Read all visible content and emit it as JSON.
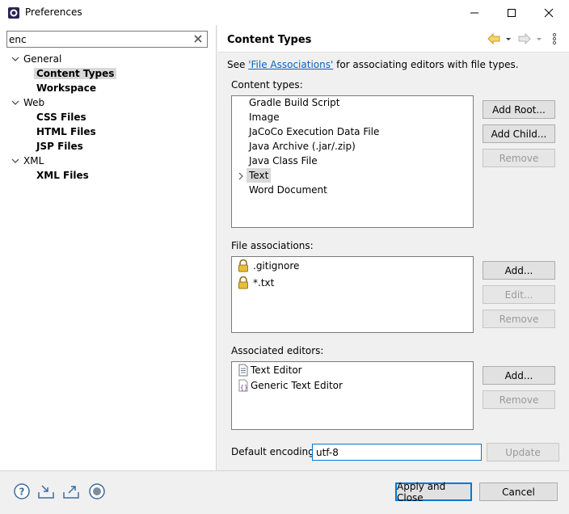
{
  "window": {
    "title": "Preferences"
  },
  "filter": {
    "value": "enc"
  },
  "tree": {
    "groups": [
      {
        "label": "General",
        "children": [
          "Content Types",
          "Workspace"
        ]
      },
      {
        "label": "Web",
        "children": [
          "CSS Files",
          "HTML Files",
          "JSP Files"
        ]
      },
      {
        "label": "XML",
        "children": [
          "XML Files"
        ]
      }
    ]
  },
  "page": {
    "title": "Content Types",
    "desc_prefix": "See ",
    "desc_link": "'File Associations'",
    "desc_suffix": " for associating editors with file types."
  },
  "content_types": {
    "label": "Content types:",
    "items": [
      "Gradle Build Script",
      "Image",
      "JaCoCo Execution Data File",
      "Java Archive (.jar/.zip)",
      "Java Class File",
      "Text",
      "Word Document"
    ],
    "selected": "Text",
    "buttons": {
      "add_root": "Add Root...",
      "add_child": "Add Child...",
      "remove": "Remove"
    }
  },
  "file_associations": {
    "label": "File associations:",
    "items": [
      ".gitignore",
      "*.txt"
    ],
    "buttons": {
      "add": "Add...",
      "edit": "Edit...",
      "remove": "Remove"
    }
  },
  "associated_editors": {
    "label": "Associated editors:",
    "items": [
      "Text Editor",
      "Generic Text Editor"
    ],
    "buttons": {
      "add": "Add...",
      "remove": "Remove"
    }
  },
  "encoding": {
    "label": "Default encoding:",
    "value": "utf-8",
    "update": "Update"
  },
  "footer": {
    "apply_close": "Apply and Close",
    "cancel": "Cancel"
  },
  "colors": {
    "link": "#0563c1",
    "focus": "#0078d7",
    "selection": "#d9d9d9"
  }
}
